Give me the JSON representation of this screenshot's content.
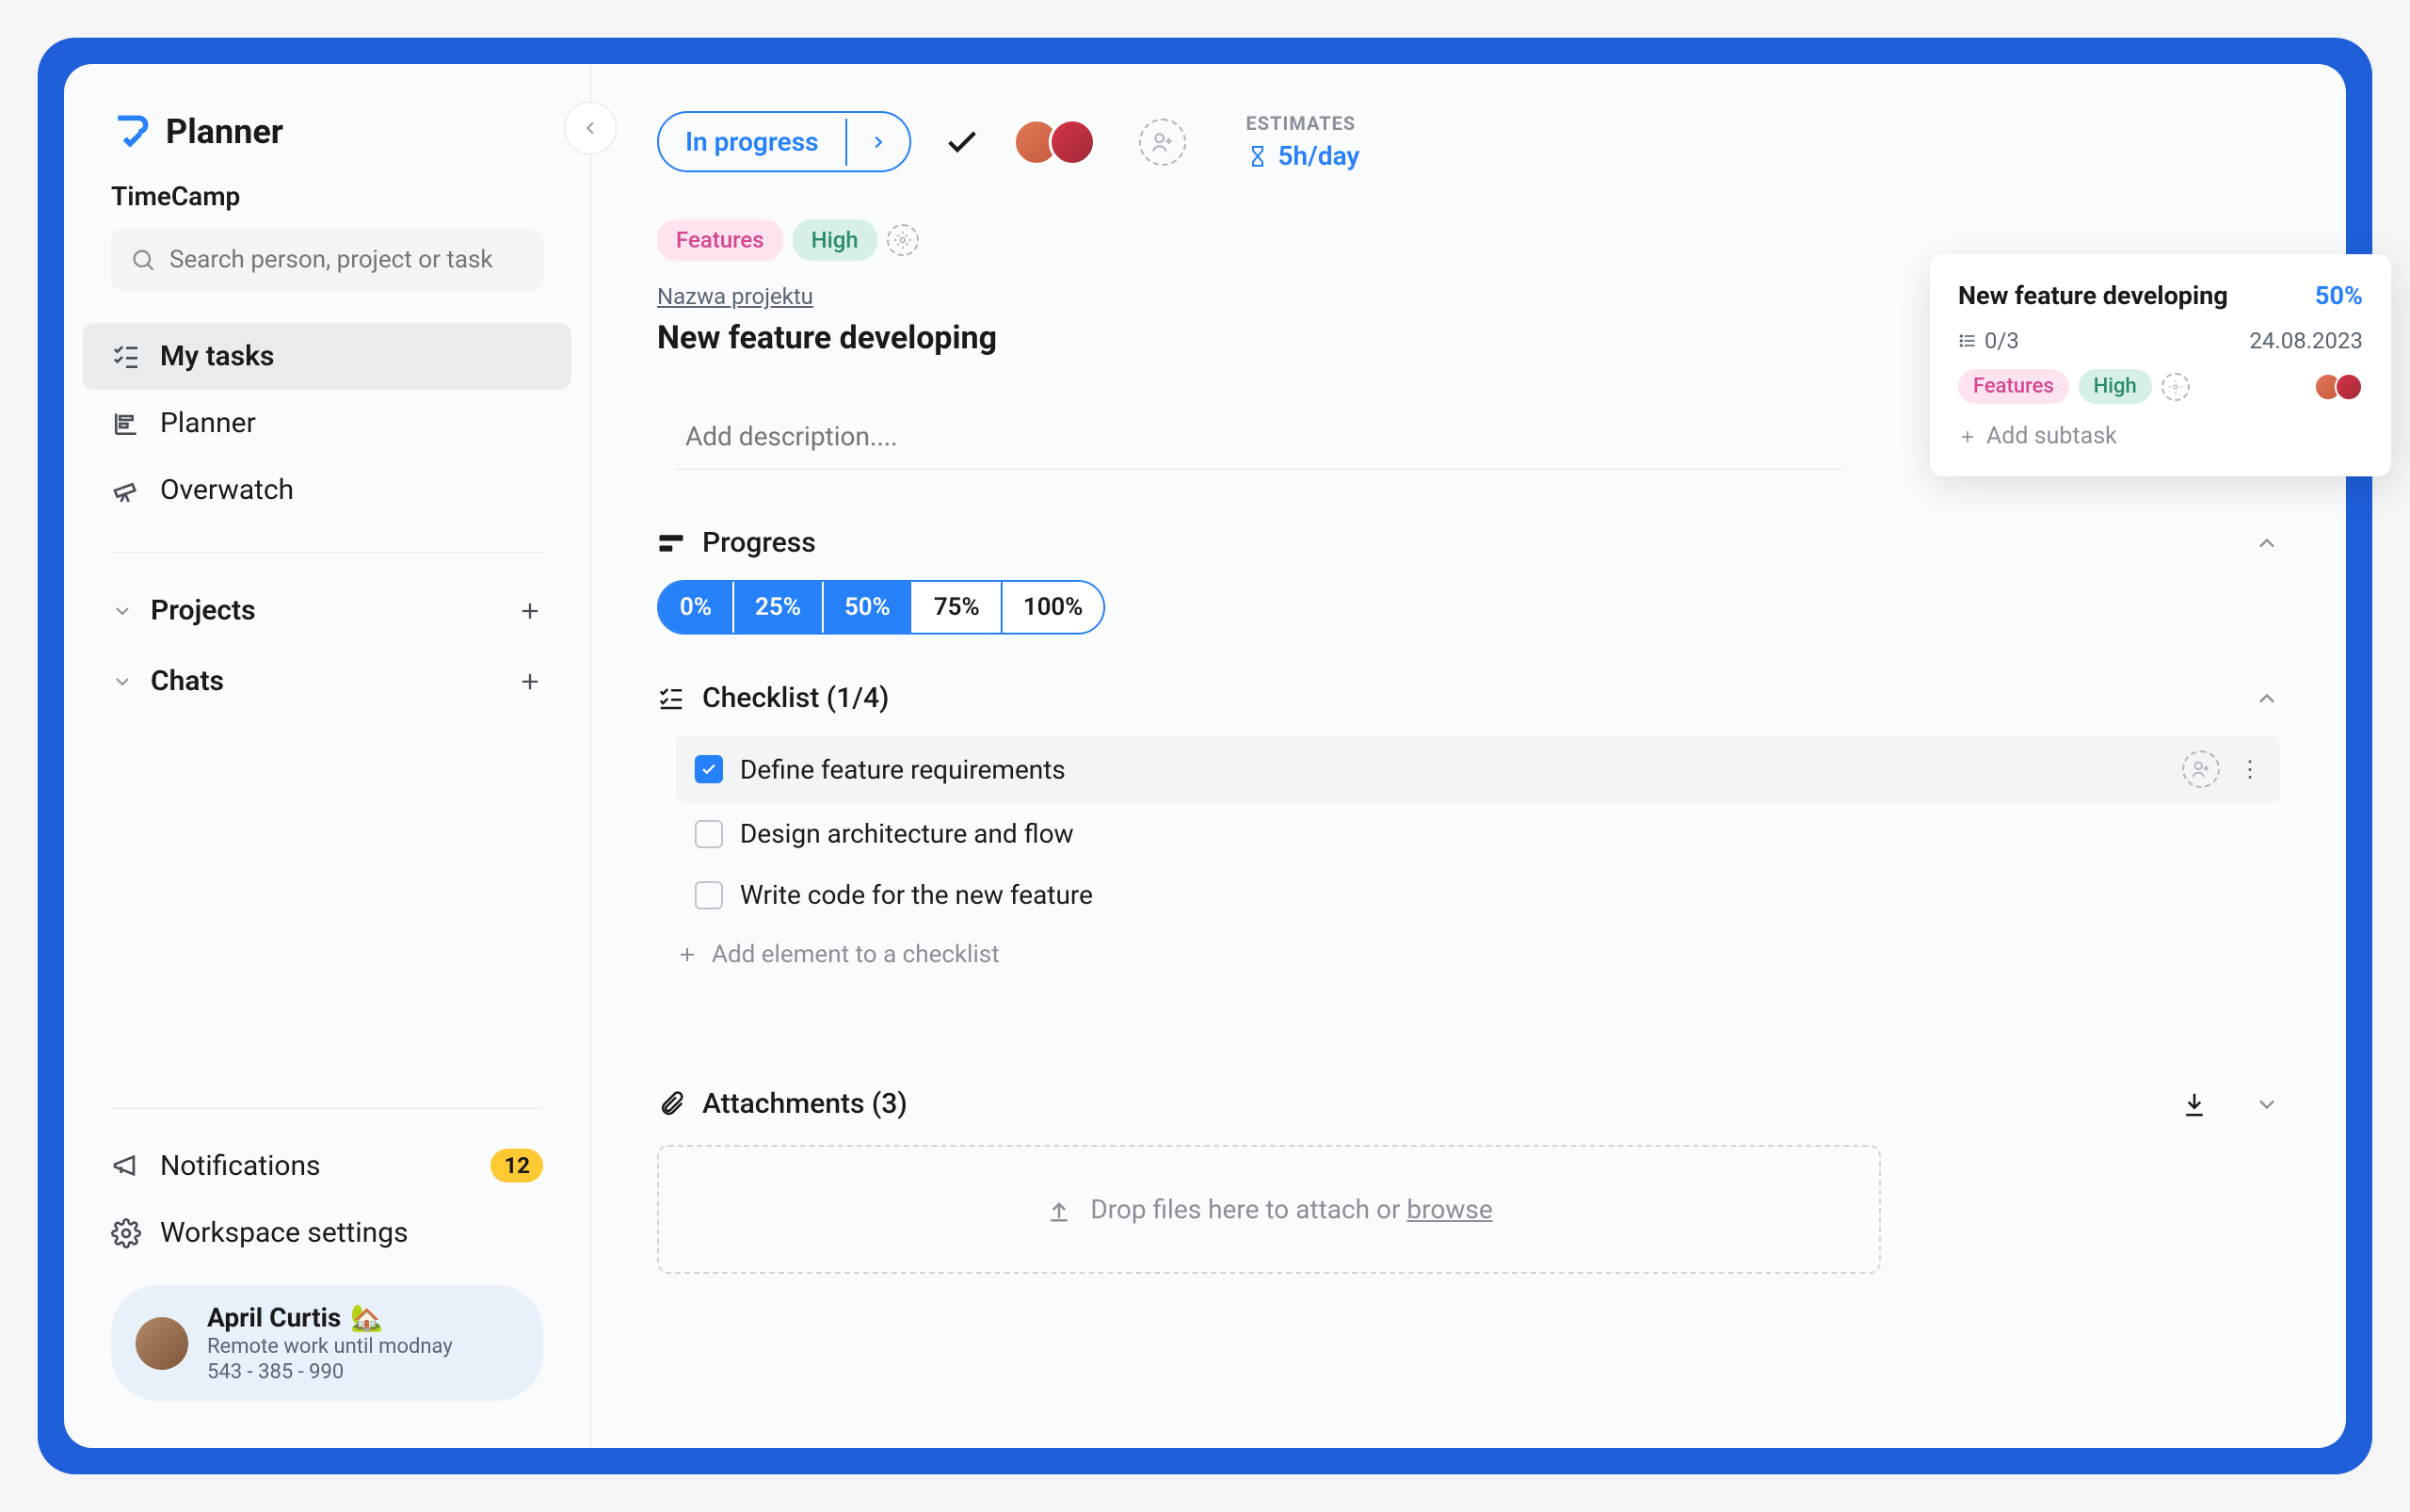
{
  "app": {
    "name": "Planner",
    "workspace": "TimeCamp"
  },
  "search": {
    "placeholder": "Search person, project or task"
  },
  "nav": {
    "mytasks": "My tasks",
    "planner": "Planner",
    "overwatch": "Overwatch",
    "projects": "Projects",
    "chats": "Chats",
    "notifications": "Notifications",
    "notif_badge": "12",
    "settings": "Workspace settings"
  },
  "user": {
    "name": "April Curtis",
    "status": "Remote work until modnay",
    "phone": "543 - 385 - 990",
    "emoji": "🏡"
  },
  "task": {
    "status": "In progress",
    "estimates_label": "ESTIMATES",
    "estimates_value": "5h/day",
    "tag_features": "Features",
    "tag_high": "High",
    "project_link": "Nazwa projektu",
    "title": "New feature developing",
    "desc_placeholder": "Add description....",
    "progress_label": "Progress",
    "progress_opts": [
      "0%",
      "25%",
      "50%",
      "75%",
      "100%"
    ],
    "progress_selected_index": 2,
    "checklist_label": "Checklist (1/4)",
    "checklist": [
      {
        "text": "Define feature requirements",
        "checked": true
      },
      {
        "text": "Design architecture and flow",
        "checked": false
      },
      {
        "text": "Write code for the new feature",
        "checked": false
      }
    ],
    "add_element": "Add element to a checklist",
    "attachments_label": "Attachments (3)",
    "drop_text": "Drop files here to attach or ",
    "browse": "browse"
  },
  "card": {
    "title": "New feature developing",
    "percent": "50%",
    "count": "0/3",
    "date": "24.08.2023",
    "tag_features": "Features",
    "tag_high": "High",
    "add_subtask": "Add subtask"
  }
}
